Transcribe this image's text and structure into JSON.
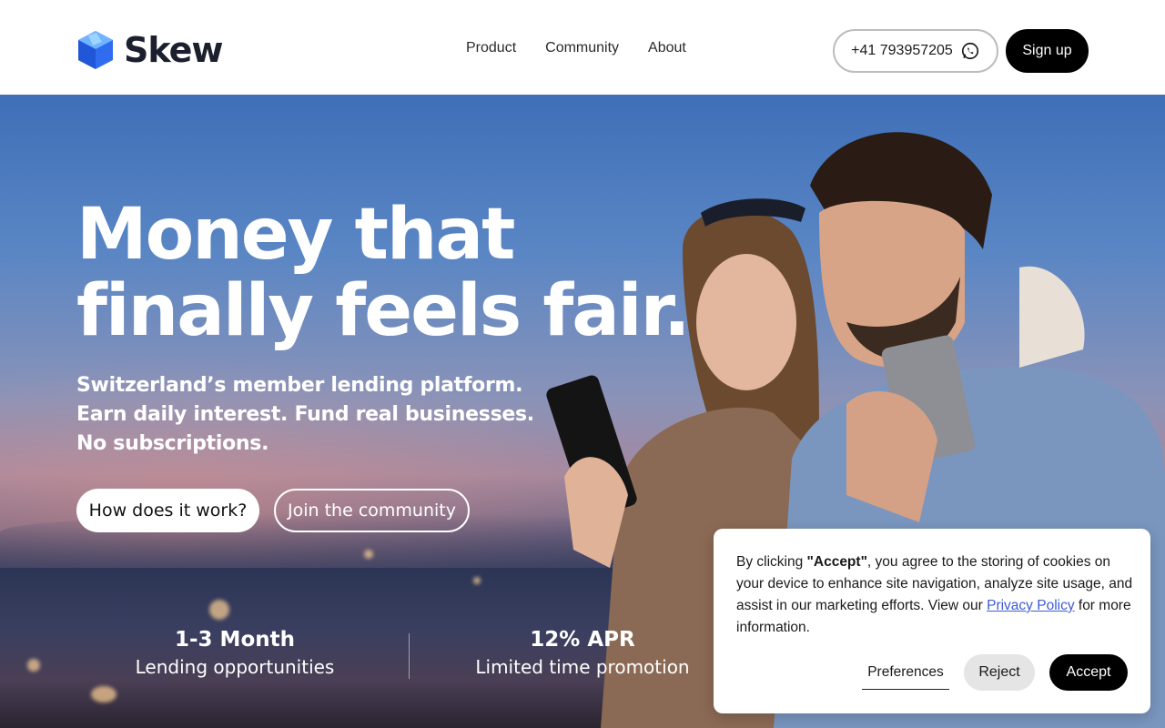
{
  "header": {
    "brand": "Skew",
    "nav": [
      {
        "label": "Product"
      },
      {
        "label": "Community"
      },
      {
        "label": "About"
      }
    ],
    "phone": "+41 793957205",
    "signup_label": "Sign up"
  },
  "hero": {
    "headline_line1": "Money that",
    "headline_line2": "finally feels fair.",
    "sub_line1": "Switzerland’s member lending platform.",
    "sub_line2": "Earn daily interest. Fund real businesses.",
    "sub_line3": "No subscriptions.",
    "cta_primary": "How does it work?",
    "cta_secondary": "Join the community",
    "stats": [
      {
        "value": "1-3 Month",
        "caption": "Lending opportunities"
      },
      {
        "value": "12% APR",
        "caption": "Limited time promotion"
      }
    ]
  },
  "cookie": {
    "prefix": "By clicking ",
    "accept_quote": "\"Accept\"",
    "middle": ", you agree to the storing of cookies on your device to enhance site navigation, analyze site usage, and assist in our marketing efforts. View our ",
    "privacy_link": "Privacy Policy",
    "suffix": " for more information.",
    "preferences_label": "Preferences",
    "reject_label": "Reject",
    "accept_label": "Accept"
  },
  "colors": {
    "brand_blue": "#2f6cf0",
    "primary_dark": "#000000",
    "link": "#3d5bd6"
  },
  "icons": {
    "logo": "skew-cube-logo",
    "phone": "whatsapp-icon"
  }
}
